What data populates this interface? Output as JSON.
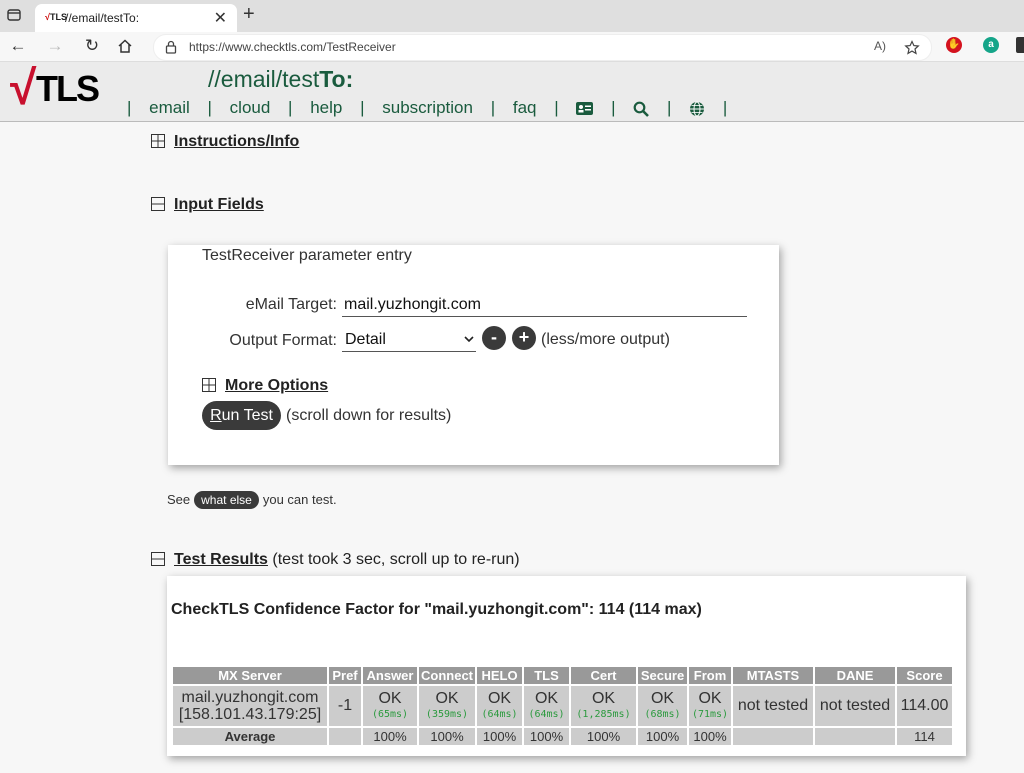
{
  "browser": {
    "tab_title": "//email/testTo:",
    "tab_favicon_text": "TLS",
    "url": "https://www.checktls.com/TestReceiver",
    "new_tab_symbol": "+",
    "close_symbol": "✕",
    "read_aloud_label": "A)"
  },
  "header": {
    "logo_text": "TLS",
    "title_prefix": "//email/test",
    "title_suffix": "To:",
    "nav": [
      {
        "label": "email"
      },
      {
        "label": "cloud"
      },
      {
        "label": "help"
      },
      {
        "label": "subscription"
      },
      {
        "label": "faq"
      }
    ],
    "separator": "|"
  },
  "sections": {
    "instructions": "Instructions/Info",
    "input_fields": "Input Fields",
    "test_results": "Test Results",
    "test_results_note": "(test took 3 sec, scroll up to re-run)"
  },
  "form": {
    "panel_title": "TestReceiver parameter entry",
    "email_label": "eMail Target:",
    "email_value": "mail.yuzhongit.com",
    "format_label": "Output Format:",
    "format_value": "Detail",
    "less_symbol": "-",
    "more_symbol": "+",
    "less_more_note": "(less/more output)",
    "more_options": "More Options",
    "run_first_letter": "R",
    "run_rest": "un Test",
    "run_note": "(scroll down for results)"
  },
  "see_line": {
    "prefix": "See",
    "pill": "what else",
    "suffix": "you can test."
  },
  "results": {
    "title": "CheckTLS Confidence Factor for \"mail.yuzhongit.com\": 114 (114 max)",
    "headers": [
      "MX Server",
      "Pref",
      "Answer",
      "Connect",
      "HELO",
      "TLS",
      "Cert",
      "Secure",
      "From",
      "MTASTS",
      "DANE",
      "Score"
    ],
    "row": {
      "server_line1": "mail.yuzhongit.com",
      "server_line2": "[158.101.43.179:25]",
      "pref": "-1",
      "answer": {
        "status": "OK",
        "time": "(65ms)"
      },
      "connect": {
        "status": "OK",
        "time": "(359ms)"
      },
      "helo": {
        "status": "OK",
        "time": "(64ms)"
      },
      "tls": {
        "status": "OK",
        "time": "(64ms)"
      },
      "cert": {
        "status": "OK",
        "time": "(1,285ms)"
      },
      "secure": {
        "status": "OK",
        "time": "(68ms)"
      },
      "from": {
        "status": "OK",
        "time": "(71ms)"
      },
      "mtasts": "not tested",
      "dane": "not tested",
      "score": "114.00"
    },
    "average": {
      "label": "Average",
      "answer": "100%",
      "connect": "100%",
      "helo": "100%",
      "tls": "100%",
      "cert": "100%",
      "secure": "100%",
      "from": "100%",
      "score": "114"
    }
  },
  "colors": {
    "brand_green": "#1a5b3e",
    "logo_red": "#c8102e",
    "ok_green": "#2b9a3e",
    "not_tested_yellow": "#ffff00"
  }
}
